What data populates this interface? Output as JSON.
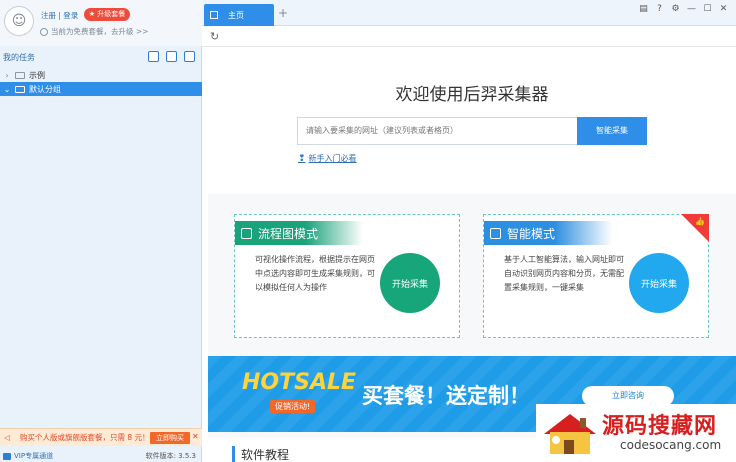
{
  "user": {
    "login_text": "注册 | 登录",
    "upgrade_label": "升级套餐",
    "plan_note": "当前为免费套餐，去升级 >>"
  },
  "tasks": {
    "title": "我的任务",
    "items": [
      {
        "label": "示例",
        "expanded": false,
        "selected": false
      },
      {
        "label": "默认分组",
        "expanded": true,
        "selected": true
      }
    ]
  },
  "promo": {
    "text": "购买个人版或旗舰版套餐，只需 8 元！",
    "buy_label": "立即购买",
    "close_label": "✕"
  },
  "footer": {
    "vip_label": "VIP专属通道",
    "version": "软件版本: 3.5.3"
  },
  "tabs": {
    "home_label": "主页",
    "add_label": "+"
  },
  "window_controls": [
    "▤",
    "?",
    "⚙",
    "—",
    "☐",
    "✕"
  ],
  "hero": {
    "welcome": "欢迎使用后羿采集器",
    "url_placeholder": "请输入要采集的网址（建议列表或者格页）",
    "smart_button": "智能采集",
    "guide_link": "新手入门必看"
  },
  "modes": {
    "flow": {
      "title": "流程图模式",
      "desc": "可视化操作流程，根据提示在网页中点选内容即可生成采集规则，可以模拟任何人为操作",
      "start": "开始采集"
    },
    "smart": {
      "title": "智能模式",
      "desc": "基于人工智能算法，输入网址即可自动识别网页内容和分页，无需配置采集规则，一键采集",
      "start": "开始采集"
    }
  },
  "banner": {
    "hot": "HOTSALE",
    "sub": "促销活动!",
    "headline": "买套餐！送定制！",
    "consult": "立即咨询"
  },
  "tutorial_title": "软件教程",
  "watermark": {
    "cn": "源码搜藏网",
    "en": "codesocang.com"
  },
  "colors": {
    "accent": "#2e8ee8",
    "flow_green": "#17a57a",
    "smart_blue": "#22a8ee",
    "promo_orange": "#f2672a",
    "badge_red": "#ef4b3a"
  }
}
